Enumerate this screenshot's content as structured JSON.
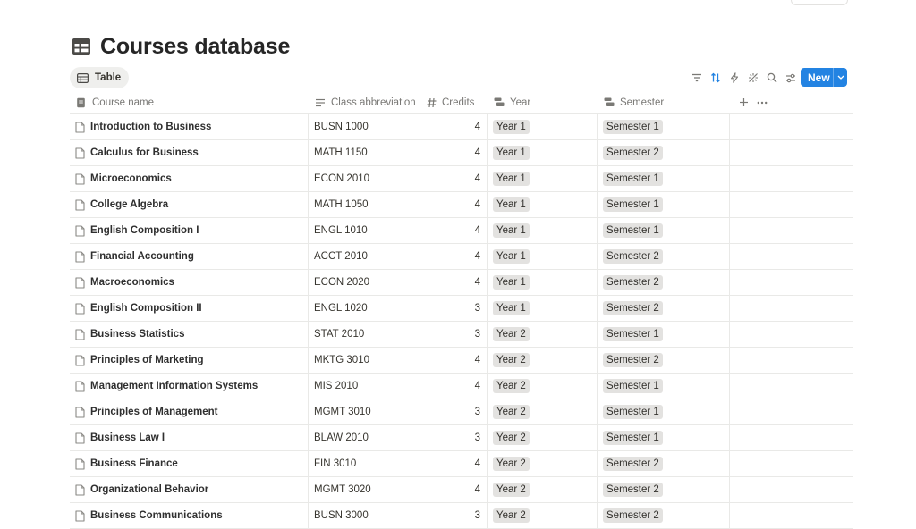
{
  "page": {
    "title": "Courses database",
    "title_icon": "table-icon"
  },
  "view_tab": {
    "label": "Table",
    "icon": "table-view-icon"
  },
  "toolbar": {
    "icons": [
      "filter-icon",
      "sort-icon",
      "automation-icon",
      "ai-sparkle-icon",
      "search-icon",
      "settings-sliders-icon"
    ],
    "new_label": "New",
    "accent": "#2383e2"
  },
  "columns": {
    "name": "Course name",
    "abbreviation": "Class abbreviation",
    "credits": "Credits",
    "year": "Year",
    "semester": "Semester"
  },
  "rows": [
    {
      "name": "Introduction to Business",
      "abbr": "BUSN 1000",
      "credits": "4",
      "year": "Year 1",
      "semester": "Semester 1"
    },
    {
      "name": "Calculus for Business",
      "abbr": "MATH 1150",
      "credits": "4",
      "year": "Year 1",
      "semester": "Semester 2"
    },
    {
      "name": "Microeconomics",
      "abbr": "ECON 2010",
      "credits": "4",
      "year": "Year 1",
      "semester": "Semester 1"
    },
    {
      "name": "College Algebra",
      "abbr": "MATH 1050",
      "credits": "4",
      "year": "Year 1",
      "semester": "Semester 1"
    },
    {
      "name": "English Composition I",
      "abbr": "ENGL 1010",
      "credits": "4",
      "year": "Year 1",
      "semester": "Semester 1"
    },
    {
      "name": "Financial Accounting",
      "abbr": "ACCT 2010",
      "credits": "4",
      "year": "Year 1",
      "semester": "Semester 2"
    },
    {
      "name": "Macroeconomics",
      "abbr": "ECON 2020",
      "credits": "4",
      "year": "Year 1",
      "semester": "Semester 2"
    },
    {
      "name": "English Composition II",
      "abbr": "ENGL 1020",
      "credits": "3",
      "year": "Year 1",
      "semester": "Semester 2"
    },
    {
      "name": "Business Statistics",
      "abbr": "STAT 2010",
      "credits": "3",
      "year": "Year 2",
      "semester": "Semester 1"
    },
    {
      "name": "Principles of Marketing",
      "abbr": "MKTG 3010",
      "credits": "4",
      "year": "Year 2",
      "semester": "Semester 2"
    },
    {
      "name": "Management Information Systems",
      "abbr": "MIS 2010",
      "credits": "4",
      "year": "Year 2",
      "semester": "Semester 1"
    },
    {
      "name": "Principles of Management",
      "abbr": "MGMT 3010",
      "credits": "3",
      "year": "Year 2",
      "semester": "Semester 1"
    },
    {
      "name": "Business Law I",
      "abbr": "BLAW 2010",
      "credits": "3",
      "year": "Year 2",
      "semester": "Semester 1"
    },
    {
      "name": "Business Finance",
      "abbr": "FIN 3010",
      "credits": "4",
      "year": "Year 2",
      "semester": "Semester 2"
    },
    {
      "name": "Organizational Behavior",
      "abbr": "MGMT 3020",
      "credits": "4",
      "year": "Year 2",
      "semester": "Semester 2"
    },
    {
      "name": "Business Communications",
      "abbr": "BUSN 3000",
      "credits": "3",
      "year": "Year 2",
      "semester": "Semester 2"
    }
  ]
}
